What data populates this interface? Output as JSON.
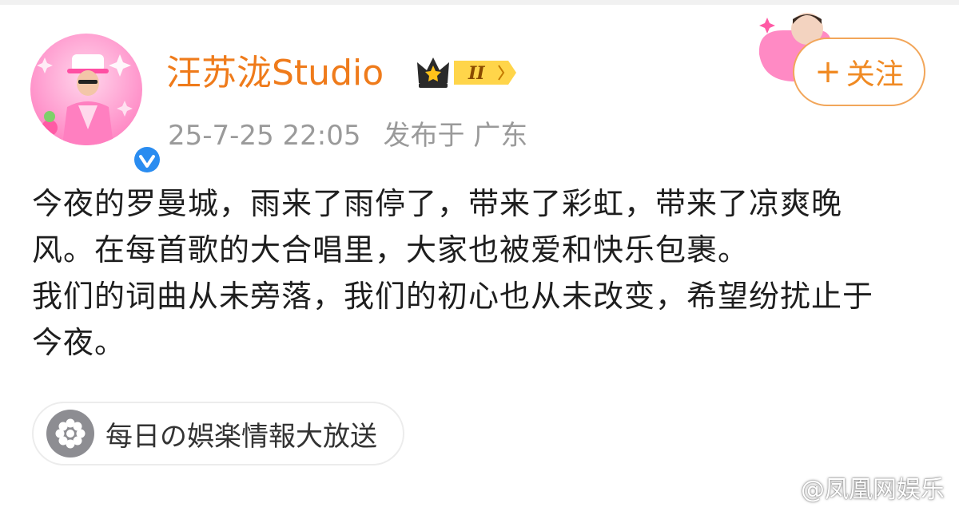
{
  "post": {
    "author_name": "汪苏泷Studio",
    "level_badge": "II",
    "date": "25-7-25 22:05",
    "location": "发布于 广东",
    "follow_label": "关注",
    "content_lines": [
      "今夜的罗曼城，雨来了雨停了，带来了彩虹，带来了凉爽晚",
      "风。在每首歌的大合唱里，大家也被爱和快乐包裹。",
      "我们的词曲从未旁落，我们的初心也从未改变，希望纷扰止于",
      "今夜。"
    ],
    "topic_label": "每日の娯楽情報大放送"
  },
  "watermark": {
    "text": "@凤凰网娱乐"
  },
  "colors": {
    "name": "#ef7b1b",
    "follow": "#f08a23",
    "meta": "#9a9a9a",
    "verified": "#2a8cf0",
    "text": "#1e1e1e"
  },
  "icons": {
    "avatar": "avatar-image",
    "verified": "verified-icon",
    "crown": "crown-icon",
    "deco": "decoration-sticker",
    "topic": "topic-flower-icon",
    "weibo": "weibo-logo-icon"
  }
}
